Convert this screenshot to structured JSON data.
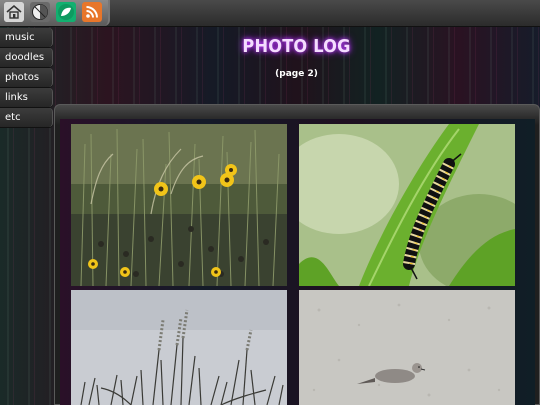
{
  "toolbar": {
    "icons": [
      "home-icon",
      "half-circle-icon",
      "leaf-icon",
      "rss-icon"
    ]
  },
  "sidebar": {
    "items": [
      {
        "label": "music"
      },
      {
        "label": "doodles"
      },
      {
        "label": "photos"
      },
      {
        "label": "links"
      },
      {
        "label": "etc"
      }
    ]
  },
  "header": {
    "title": "PHOTO LOG",
    "subtitle": "(page 2)"
  },
  "gallery": {
    "photos": [
      {
        "subject": "yellow-wildflowers"
      },
      {
        "subject": "caterpillar-on-leaf"
      },
      {
        "subject": "grass-against-sky"
      },
      {
        "subject": "dove-on-sand"
      }
    ]
  },
  "colors": {
    "title_glow": "#a020f0",
    "toolbar_bg": "#3a3a3a"
  }
}
